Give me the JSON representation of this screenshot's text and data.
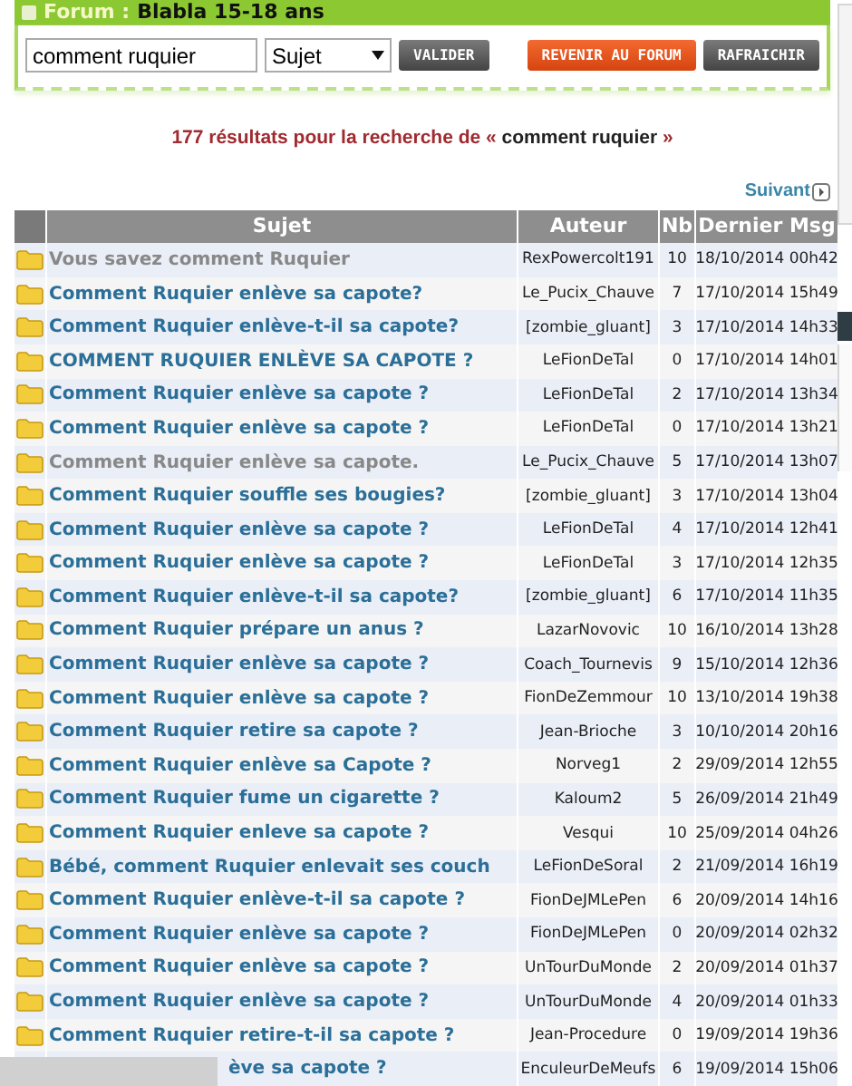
{
  "forum_header": {
    "label": "Forum :",
    "name": "Blabla 15-18 ans"
  },
  "search": {
    "value": "comment ruquier",
    "scope": "Sujet",
    "submit": "VALIDER"
  },
  "actions": [
    {
      "label": "REVENIR AU FORUM",
      "kind": "primary"
    },
    {
      "label": "RAFRAICHIR",
      "kind": "secondary"
    }
  ],
  "results": {
    "prefix": "177 résultats pour la recherche de «",
    "query": "comment ruquier",
    "suffix": "»"
  },
  "pagination": {
    "next": "Suivant"
  },
  "table": {
    "columns": [
      "Sujet",
      "Auteur",
      "Nb",
      "Dernier Msg"
    ],
    "rows": [
      {
        "subject": "Vous savez comment Ruquier",
        "author": "RexPowercolt191",
        "count": "10",
        "last": "18/10/2014 00h42",
        "visited": true
      },
      {
        "subject": "Comment Ruquier enlève sa capote?",
        "author": "Le_Pucix_Chauve",
        "count": "7",
        "last": "17/10/2014 15h49",
        "visited": false
      },
      {
        "subject": "Comment Ruquier enlève-t-il sa capote?",
        "author": "[zombie_gluant]",
        "count": "3",
        "last": "17/10/2014 14h33",
        "visited": false
      },
      {
        "subject": "COMMENT RUQUIER ENLÈVE SA CAPOTE ?",
        "author": "LeFionDeTal",
        "count": "0",
        "last": "17/10/2014 14h01",
        "visited": false
      },
      {
        "subject": "Comment Ruquier enlève sa capote ?",
        "author": "LeFionDeTal",
        "count": "2",
        "last": "17/10/2014 13h34",
        "visited": false
      },
      {
        "subject": "Comment Ruquier enlève sa capote ?",
        "author": "LeFionDeTal",
        "count": "0",
        "last": "17/10/2014 13h21",
        "visited": false
      },
      {
        "subject": "Comment Ruquier enlève sa capote.",
        "author": "Le_Pucix_Chauve",
        "count": "5",
        "last": "17/10/2014 13h07",
        "visited": true
      },
      {
        "subject": "Comment Ruquier souffle ses bougies?",
        "author": "[zombie_gluant]",
        "count": "3",
        "last": "17/10/2014 13h04",
        "visited": false
      },
      {
        "subject": "Comment Ruquier enlève sa capote ?",
        "author": "LeFionDeTal",
        "count": "4",
        "last": "17/10/2014 12h41",
        "visited": false
      },
      {
        "subject": "Comment Ruquier enlève sa capote ?",
        "author": "LeFionDeTal",
        "count": "3",
        "last": "17/10/2014 12h35",
        "visited": false
      },
      {
        "subject": "Comment Ruquier enlève-t-il sa capote?",
        "author": "[zombie_gluant]",
        "count": "6",
        "last": "17/10/2014 11h35",
        "visited": false
      },
      {
        "subject": "Comment Ruquier prépare un anus ?",
        "author": "LazarNovovic",
        "count": "10",
        "last": "16/10/2014 13h28",
        "visited": false
      },
      {
        "subject": "Comment Ruquier enlève sa capote ?",
        "author": "Coach_Tournevis",
        "count": "9",
        "last": "15/10/2014 12h36",
        "visited": false
      },
      {
        "subject": "Comment Ruquier enlève sa capote ?",
        "author": "FionDeZemmour",
        "count": "10",
        "last": "13/10/2014 19h38",
        "visited": false
      },
      {
        "subject": "Comment Ruquier retire sa capote ?",
        "author": "Jean-Brioche",
        "count": "3",
        "last": "10/10/2014 20h16",
        "visited": false
      },
      {
        "subject": "Comment Ruquier enlève sa Capote ?",
        "author": "Norveg1",
        "count": "2",
        "last": "29/09/2014 12h55",
        "visited": false
      },
      {
        "subject": "Comment Ruquier fume un cigarette ?",
        "author": "Kaloum2",
        "count": "5",
        "last": "26/09/2014 21h49",
        "visited": false
      },
      {
        "subject": "Comment Ruquier enleve sa capote ?",
        "author": "Vesqui",
        "count": "10",
        "last": "25/09/2014 04h26",
        "visited": false
      },
      {
        "subject": "Bébé, comment Ruquier enlevait ses couch",
        "author": "LeFionDeSoral",
        "count": "2",
        "last": "21/09/2014 16h19",
        "visited": false
      },
      {
        "subject": "Comment Ruquier enlève-t-il sa capote ?",
        "author": "FionDeJMLePen",
        "count": "6",
        "last": "20/09/2014 14h16",
        "visited": false
      },
      {
        "subject": "Comment Ruquier enlève sa capote ?",
        "author": "FionDeJMLePen",
        "count": "0",
        "last": "20/09/2014 02h32",
        "visited": false
      },
      {
        "subject": "Comment Ruquier enlève sa capote ?",
        "author": "UnTourDuMonde",
        "count": "2",
        "last": "20/09/2014 01h37",
        "visited": false
      },
      {
        "subject": "Comment Ruquier enlève sa capote ?",
        "author": "UnTourDuMonde",
        "count": "4",
        "last": "20/09/2014 01h33",
        "visited": false
      },
      {
        "subject": "Comment Ruquier retire-t-il sa capote ?",
        "author": "Jean-Procedure",
        "count": "0",
        "last": "19/09/2014 19h36",
        "visited": false
      },
      {
        "subject": "ève sa capote ?",
        "author": "EnculeurDeMeufs",
        "count": "6",
        "last": "19/09/2014 15h06",
        "visited": false,
        "covered": true
      }
    ]
  }
}
